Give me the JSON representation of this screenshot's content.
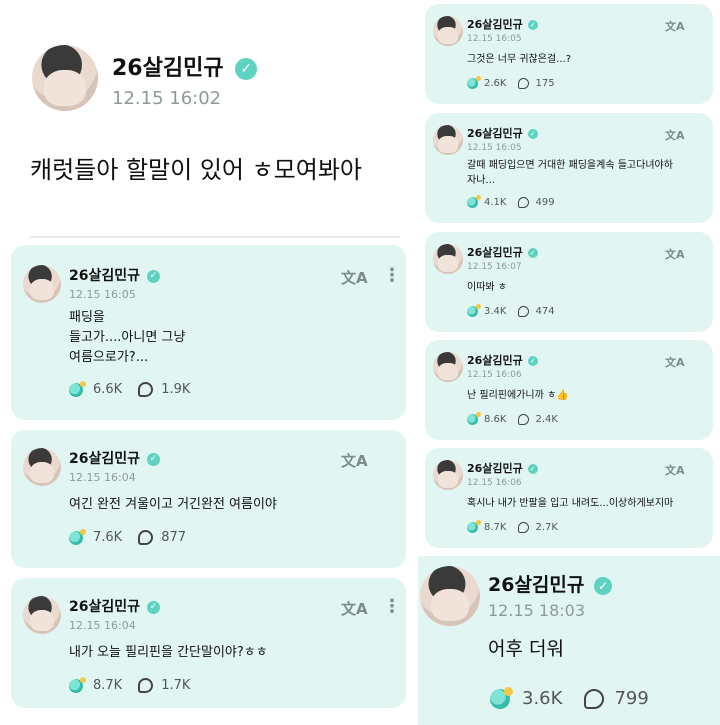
{
  "username": "26살김민규",
  "verified_mark": "✓",
  "translate_glyph": "文A",
  "more_glyph": "⋮",
  "top_post": {
    "time": "12.15 16:02",
    "text": "캐럿들아 할말이 있어 ㅎ모여봐아"
  },
  "left_posts": [
    {
      "time": "12.15 16:05",
      "text": "패딩을\n들고가....아니면 그냥\n여름으로가?...",
      "likes": "6.6K",
      "comments": "1.9K"
    },
    {
      "time": "12.15 16:04",
      "text": "여긴 완전 겨울이고 거긴완전 여름이야",
      "likes": "7.6K",
      "comments": "877"
    },
    {
      "time": "12.15 16:04",
      "text": "내가 오늘 필리핀을 간단말이야?ㅎㅎ",
      "likes": "8.7K",
      "comments": "1.7K"
    }
  ],
  "right_posts": [
    {
      "time": "12.15 16:05",
      "text": "그것은 너무 귀찮은걸...?",
      "likes": "2.6K",
      "comments": "175"
    },
    {
      "time": "12.15 16:05",
      "text": "갈때 패딩입으면 거대한 패딩을계속 들고다녀야하\n자나...",
      "likes": "4.1K",
      "comments": "499"
    },
    {
      "time": "12.15 16:07",
      "text": "이따봐 ㅎ",
      "likes": "3.4K",
      "comments": "474"
    },
    {
      "time": "12.15 16:06",
      "text": "난 필리핀에가니까 ㅎ👍",
      "likes": "8.6K",
      "comments": "2.4K"
    },
    {
      "time": "12.15 16:06",
      "text": "혹시나 내가 반팔을 입고 내려도...이상하게보지마",
      "likes": "8.7K",
      "comments": "2.7K"
    }
  ],
  "bottom_post": {
    "time": "12.15 18:03",
    "text": "어후 더워",
    "likes": "3.6K",
    "comments": "799"
  },
  "colors": {
    "card_bg": "#e1f6f3",
    "verified": "#5fd2c1",
    "time_text": "#8e9a99"
  },
  "icons": [
    "avatar",
    "verified-badge-icon",
    "translate-icon",
    "more-icon",
    "light-stick-icon",
    "comment-bubble-icon"
  ]
}
